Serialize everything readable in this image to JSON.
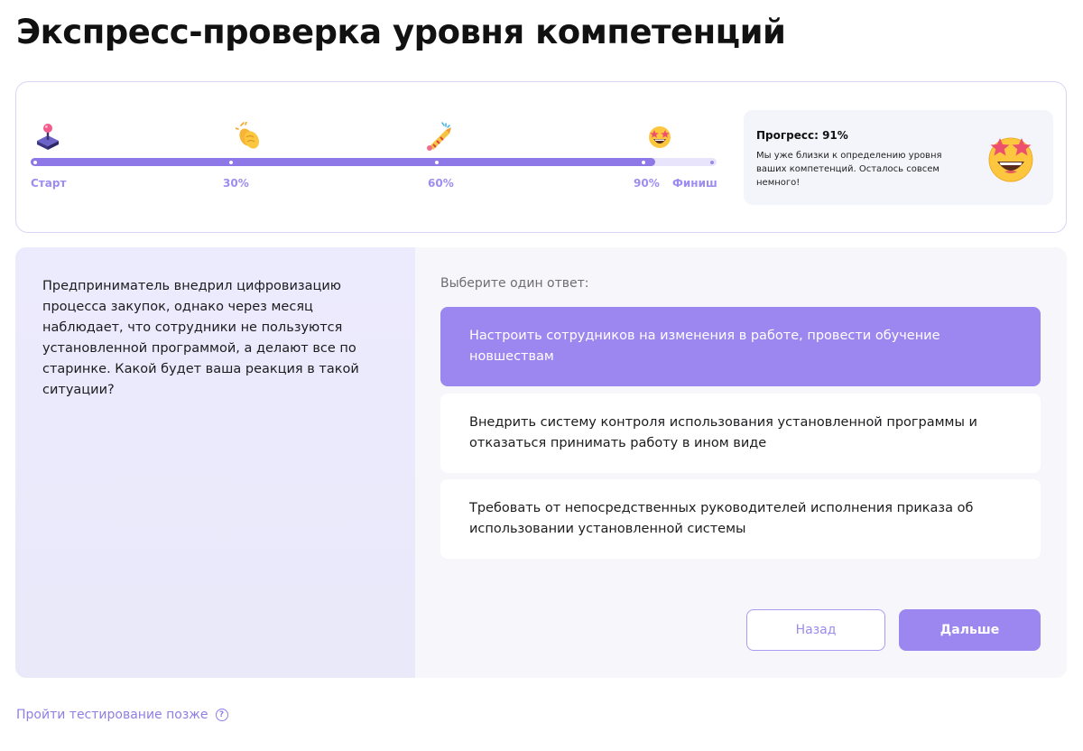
{
  "page": {
    "title": "Экспресс-проверка уровня компетенций"
  },
  "progress": {
    "percent": 91,
    "milestones": [
      {
        "label": "Старт",
        "icon": "joystick-icon",
        "value": 0
      },
      {
        "label": "30%",
        "icon": "clapping-hands-icon",
        "value": 30
      },
      {
        "label": "60%",
        "icon": "party-horn-icon",
        "value": 60
      },
      {
        "label": "90%",
        "icon": "star-struck-icon",
        "value": 90
      },
      {
        "label": "Финиш",
        "value": 100
      }
    ],
    "info": {
      "title": "Прогресс: 91%",
      "text": "Мы уже близки к определению уровня ваших компетенций. Осталось совсем немного!",
      "icon": "star-struck-face-icon"
    }
  },
  "question": {
    "text": "Предприниматель внедрил цифровизацию процесса закупок, однако через месяц наблюдает, что сотрудники не пользуются установленной программой, а делают все по старинке. Какой будет ваша реакция в такой ситуации?",
    "choose_label": "Выберите один ответ:",
    "answers": [
      {
        "text": "Настроить сотрудников на изменения в работе, провести обучение новшествам",
        "selected": true
      },
      {
        "text": "Внедрить систему контроля использования установленной программы и отказаться принимать работу в ином виде",
        "selected": false
      },
      {
        "text": "Требовать от непосредственных руководителей исполнения приказа об использовании установленной системы",
        "selected": false
      }
    ]
  },
  "buttons": {
    "back": "Назад",
    "next": "Дальше"
  },
  "footer": {
    "later_link": "Пройти тестирование позже",
    "help_icon": "question-circle-icon"
  },
  "colors": {
    "accent": "#9b87ef",
    "progress_fill": "#8e78e8",
    "progress_track": "#e8e4fb",
    "link": "#8f7fe4"
  }
}
